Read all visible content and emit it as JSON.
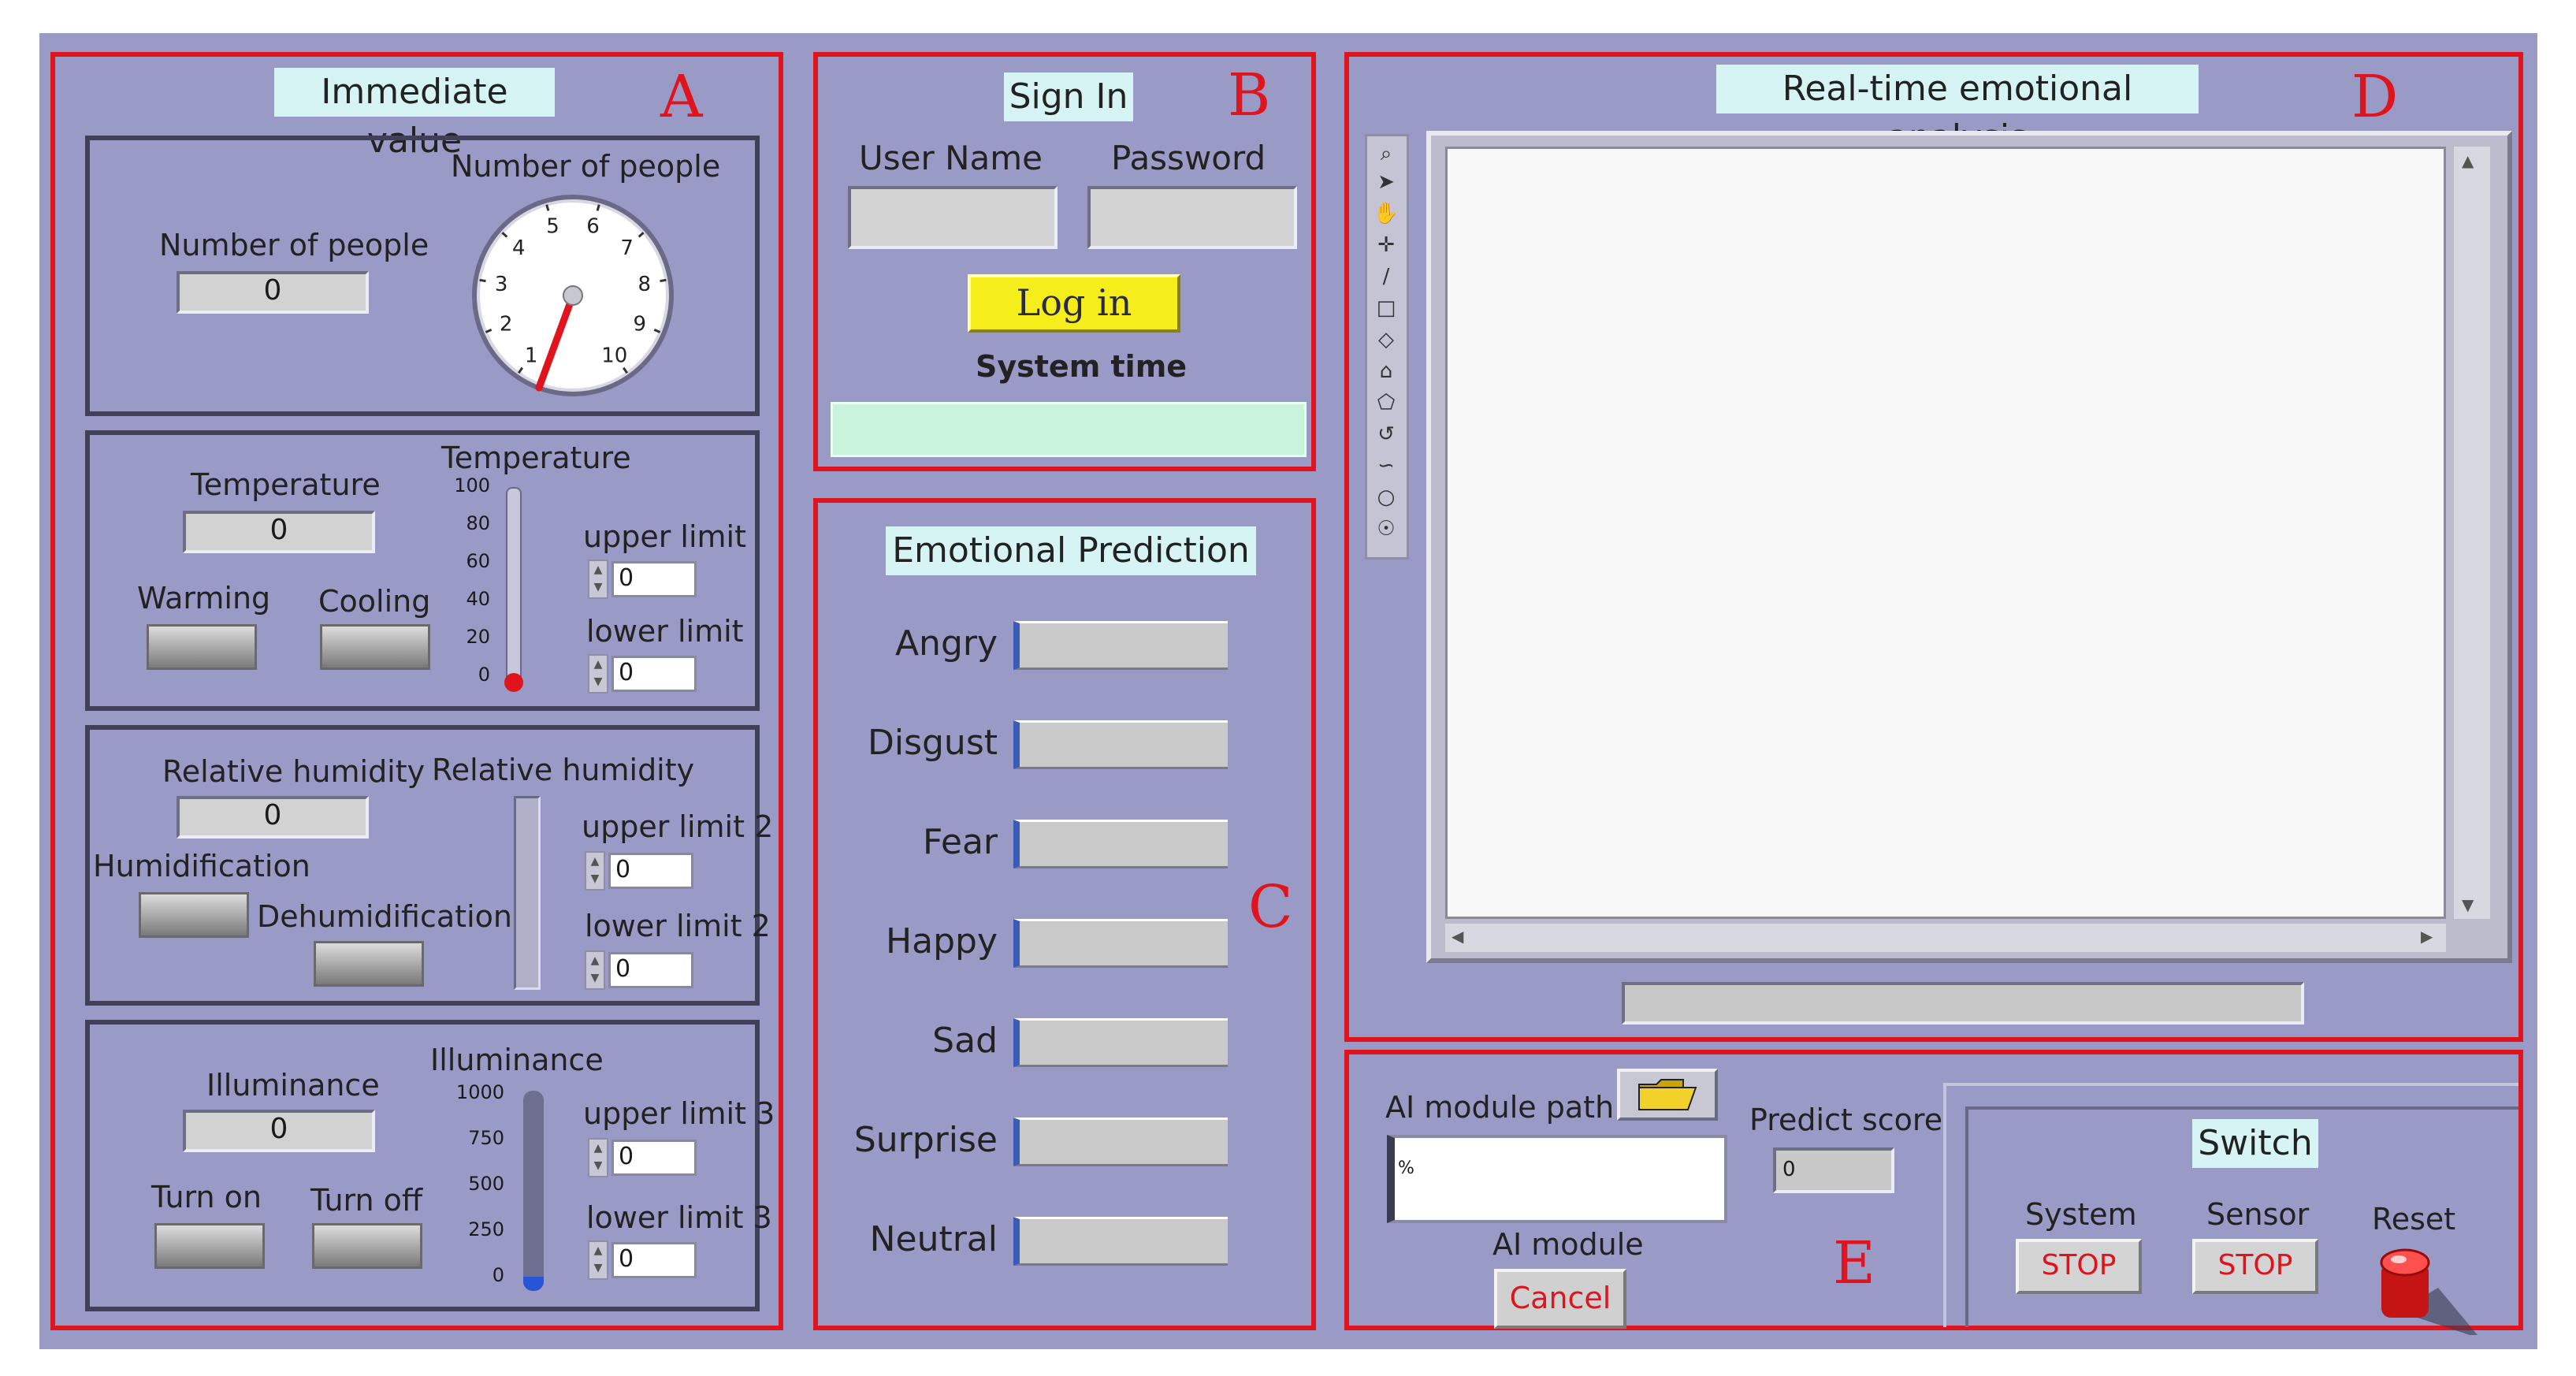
{
  "panelA": {
    "title": "Immediate value",
    "letter": "A",
    "people": {
      "label": "Number of people",
      "value": "0",
      "gauge_label": "Number of people",
      "gauge_ticks": [
        "1",
        "2",
        "3",
        "4",
        "5",
        "6",
        "7",
        "8",
        "9",
        "10"
      ],
      "gauge_value": 0
    },
    "temperature": {
      "label": "Temperature",
      "value": "0",
      "thermo_label": "Temperature",
      "scale": [
        "100",
        "80",
        "60",
        "40",
        "20",
        "0"
      ],
      "level": 0,
      "warming": "Warming",
      "cooling": "Cooling",
      "upper_label": "upper limit",
      "upper_value": "0",
      "lower_label": "lower limit",
      "lower_value": "0"
    },
    "humidity": {
      "label": "Relative humidity",
      "value": "0",
      "bar_label": "Relative humidity",
      "level": 0,
      "humidification": "Humidification",
      "dehumidification": "Dehumidification",
      "upper_label": "upper limit 2",
      "upper_value": "0",
      "lower_label": "lower limit 2",
      "lower_value": "0"
    },
    "illuminance": {
      "label": "Illuminance",
      "value": "0",
      "bar_label": "Illuminance",
      "scale": [
        "1000",
        "750",
        "500",
        "250",
        "0"
      ],
      "level": 0,
      "turn_on": "Turn on",
      "turn_off": "Turn off",
      "upper_label": "upper limit 3",
      "upper_value": "0",
      "lower_label": "lower limit 3",
      "lower_value": "0"
    }
  },
  "panelB": {
    "title": "Sign In",
    "letter": "B",
    "username_label": "User Name",
    "password_label": "Password",
    "login_button": "Log in",
    "system_time_label": "System time",
    "system_time_value": ""
  },
  "panelC": {
    "title": "Emotional Prediction",
    "letter": "C",
    "emotions": [
      "Angry",
      "Disgust",
      "Fear",
      "Happy",
      "Sad",
      "Surprise",
      "Neutral"
    ]
  },
  "panelD": {
    "title": "Real-time emotional analysis",
    "letter": "D",
    "status_value": ""
  },
  "panelE": {
    "letter": "E",
    "ai_path_label": "AI module path",
    "ai_path_value": "%",
    "ai_module_label": "AI module",
    "cancel_button": "Cancel",
    "predict_label": "Predict score",
    "predict_value": "0",
    "switch_title": "Switch",
    "system_label": "System",
    "system_button": "STOP",
    "sensor_label": "Sensor",
    "sensor_button": "STOP",
    "reset_label": "Reset"
  },
  "colors": {
    "background": "#9a9ac6",
    "panel_border": "#e0141c",
    "title_bg": "#d6f4f4",
    "login_button": "#f6ee1a",
    "system_time_bg": "#c8f4dc"
  },
  "icons": [
    "zoom-icon",
    "arrow-icon",
    "hand-icon",
    "crosshair-icon",
    "line-icon",
    "rectangle-icon",
    "rounded-rectangle-icon",
    "polygon-icon",
    "oval-icon",
    "arc-icon",
    "freeform-icon",
    "erase-icon",
    "lasso-icon",
    "folder-icon"
  ]
}
